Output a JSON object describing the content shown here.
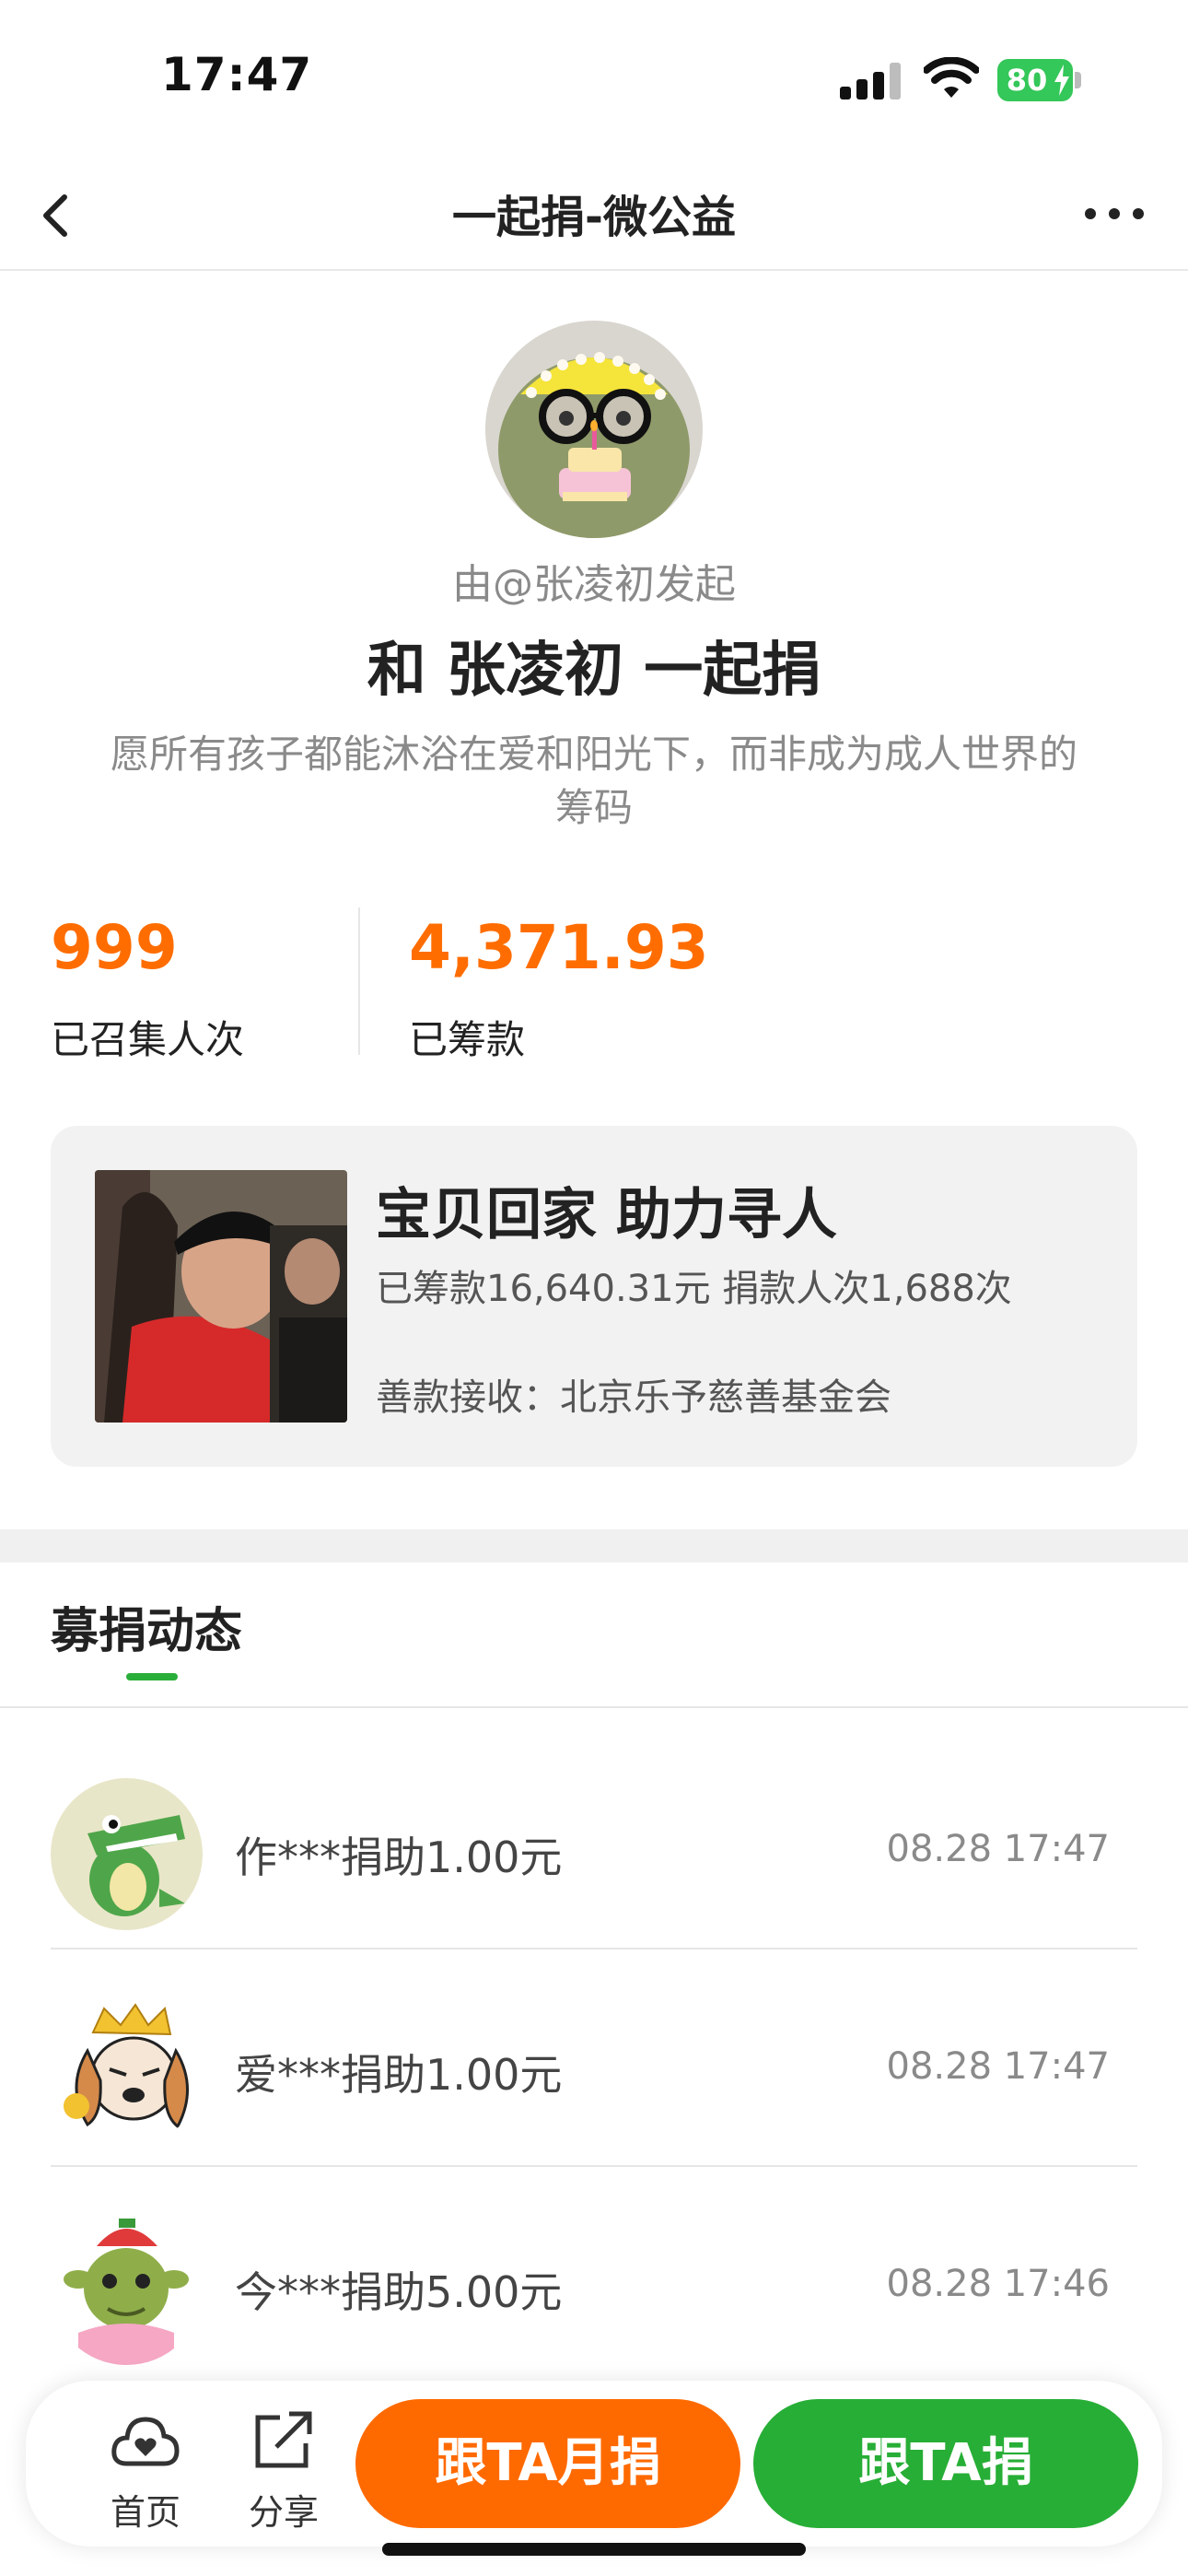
{
  "status_bar": {
    "time": "17:47",
    "battery": "80"
  },
  "nav": {
    "title": "一起捐-微公益"
  },
  "initiator": {
    "by_text": "由@张凌初发起",
    "headline": "和 张凌初 一起捐",
    "slogan": "愿所有孩子都能沐浴在爱和阳光下，而非成为成人世界的筹码"
  },
  "stats": {
    "participants": {
      "value": "999",
      "label": "已召集人次"
    },
    "raised": {
      "value": "4,371.93",
      "label": "已筹款"
    }
  },
  "project": {
    "title": "宝贝回家 助力寻人",
    "stats": "已筹款16,640.31元  捐款人次1,688次",
    "receiver": "善款接收：北京乐予慈善基金会"
  },
  "feed": {
    "title": "募捐动态",
    "items": [
      {
        "text": "作***捐助1.00元",
        "time": "08.28 17:47",
        "avatar": "crocodile-avatar"
      },
      {
        "text": "爱***捐助1.00元",
        "time": "08.28 17:47",
        "avatar": "puppy-crown-avatar"
      },
      {
        "text": "今***捐助5.00元",
        "time": "08.28 17:46",
        "avatar": "ogre-strawberry-avatar"
      }
    ]
  },
  "bottom_bar": {
    "home_label": "首页",
    "share_label": "分享",
    "monthly_button": "跟TA月捐",
    "donate_button": "跟TA捐"
  },
  "colors": {
    "orange": "#ff6a00",
    "green": "#27ae36",
    "battery": "#34c759"
  }
}
